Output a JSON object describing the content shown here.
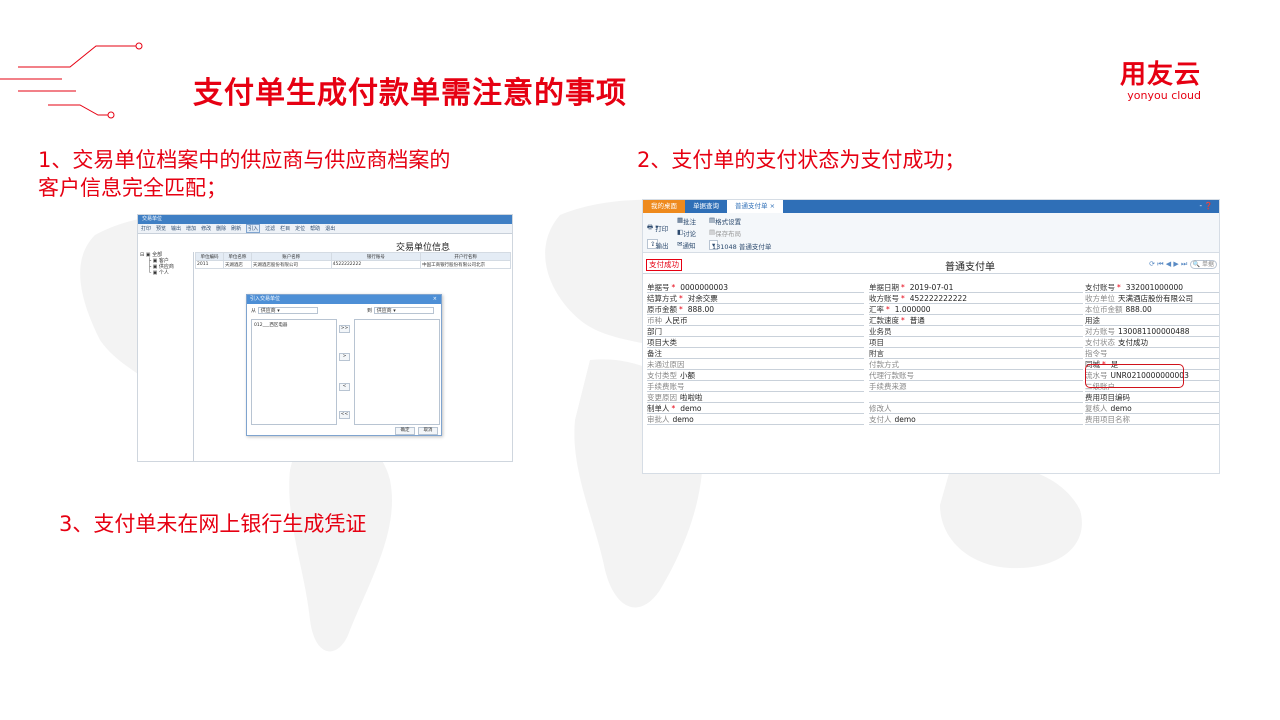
{
  "slide": {
    "title": "支付单生成付款单需注意的事项",
    "logo": {
      "main": "用友云",
      "sub": "yonyou cloud"
    },
    "points": [
      "1、交易单位档案中的供应商与供应商档案的客户信息完全匹配；",
      "2、支付单的支付状态为支付成功；",
      "3、支付单未在网上银行生成凭证"
    ],
    "colors": {
      "accent": "#e60012"
    }
  },
  "shot1": {
    "window_title": "交易单位",
    "toolbar": [
      "打印",
      "预览",
      "输出",
      "增加",
      "修改",
      "删除",
      "刷新",
      "引入",
      "过滤",
      "栏目",
      "定位",
      "帮助",
      "退出"
    ],
    "heading": "交易单位信息",
    "tree": [
      "全部",
      "客户",
      "供应商",
      "个人"
    ],
    "columns": [
      "单位编码",
      "单位名称",
      "账户名称",
      "银行账号",
      "开户行名称"
    ],
    "row": [
      "2011",
      "天湖酒店",
      "天湖酒店股份有限公司",
      "4522222222",
      "中国工商银行股份有限公司北京"
    ],
    "dialog": {
      "title": "引入交易单位",
      "from_label": "从",
      "from_value": "供应商",
      "to_label": "到",
      "to_value": "供应商",
      "list_item": "012___西区电器",
      "buttons": [
        ">>",
        ">",
        "<",
        "<<"
      ],
      "ok": "确定",
      "cancel": "取消"
    }
  },
  "shot2": {
    "tabs": [
      "我的桌面",
      "单据查询",
      "普通支付单"
    ],
    "toolbar": {
      "print": "打印",
      "output": "输出",
      "approve": "批注",
      "discuss": "讨论",
      "notify": "通知",
      "format": "格式设置",
      "save_layout": "保存布局",
      "template": "131048 普通支付单"
    },
    "stamp": "支付成功",
    "form_title": "普通支付单",
    "search_placeholder": "单据",
    "fields_col1": [
      {
        "label": "单据号",
        "required": true,
        "value": "0000000003"
      },
      {
        "label": "结算方式",
        "required": true,
        "value": "对余交票"
      },
      {
        "label": "原币金额",
        "required": true,
        "value": "888.00"
      },
      {
        "label": "币种",
        "required": false,
        "value": "人民币",
        "gray": true
      },
      {
        "label": "部门",
        "required": false,
        "value": ""
      },
      {
        "label": "项目大类",
        "required": false,
        "value": ""
      },
      {
        "label": "备注",
        "required": false,
        "value": ""
      },
      {
        "label": "未通过原因",
        "required": false,
        "value": "",
        "gray": true
      },
      {
        "label": "支付类型",
        "required": false,
        "value": "小额",
        "gray": true
      },
      {
        "label": "手续费账号",
        "required": false,
        "value": "",
        "gray": true
      },
      {
        "label": "变更原因",
        "required": false,
        "value": "啦啦啦",
        "gray": true
      },
      {
        "label": "制单人",
        "required": true,
        "value": "demo"
      },
      {
        "label": "审批人",
        "required": false,
        "value": "demo",
        "gray": true
      }
    ],
    "fields_col2": [
      {
        "label": "单据日期",
        "required": true,
        "value": "2019-07-01"
      },
      {
        "label": "收方账号",
        "required": true,
        "value": "452222222222"
      },
      {
        "label": "汇率",
        "required": true,
        "value": "1.000000"
      },
      {
        "label": "汇款速度",
        "required": true,
        "value": "普通"
      },
      {
        "label": "业务员",
        "required": false,
        "value": ""
      },
      {
        "label": "项目",
        "required": false,
        "value": ""
      },
      {
        "label": "附言",
        "required": false,
        "value": ""
      },
      {
        "label": "付款方式",
        "required": false,
        "value": "",
        "gray": true
      },
      {
        "label": "代理行款账号",
        "required": false,
        "value": "",
        "gray": true
      },
      {
        "label": "手续费来源",
        "required": false,
        "value": "",
        "gray": true
      },
      {
        "label": "",
        "required": false,
        "value": ""
      },
      {
        "label": "修改人",
        "required": false,
        "value": "",
        "gray": true
      },
      {
        "label": "支付人",
        "required": false,
        "value": "demo",
        "gray": true
      }
    ],
    "fields_col3": [
      {
        "label": "支付账号",
        "required": true,
        "value": "332001000000"
      },
      {
        "label": "收方单位",
        "required": false,
        "value": "天满酒店股份有限公司",
        "gray": true
      },
      {
        "label": "本位币金额",
        "required": false,
        "value": "888.00",
        "gray": true
      },
      {
        "label": "用途",
        "required": false,
        "value": ""
      },
      {
        "label": "对方账号",
        "required": false,
        "value": "130081100000488",
        "gray": true
      },
      {
        "label": "支付状态",
        "required": false,
        "value": "支付成功",
        "gray": true
      },
      {
        "label": "指令号",
        "required": false,
        "value": "",
        "gray": true
      },
      {
        "label": "同城",
        "required": true,
        "value": "是"
      },
      {
        "label": "流水号",
        "required": false,
        "value": "UNR0210000000003",
        "gray": true
      },
      {
        "label": "二级账户",
        "required": false,
        "value": "",
        "gray": true
      },
      {
        "label": "费用项目编码",
        "required": false,
        "value": ""
      },
      {
        "label": "复核人",
        "required": false,
        "value": "demo",
        "gray": true
      },
      {
        "label": "费用项目名称",
        "required": false,
        "value": "",
        "gray": true
      }
    ]
  }
}
